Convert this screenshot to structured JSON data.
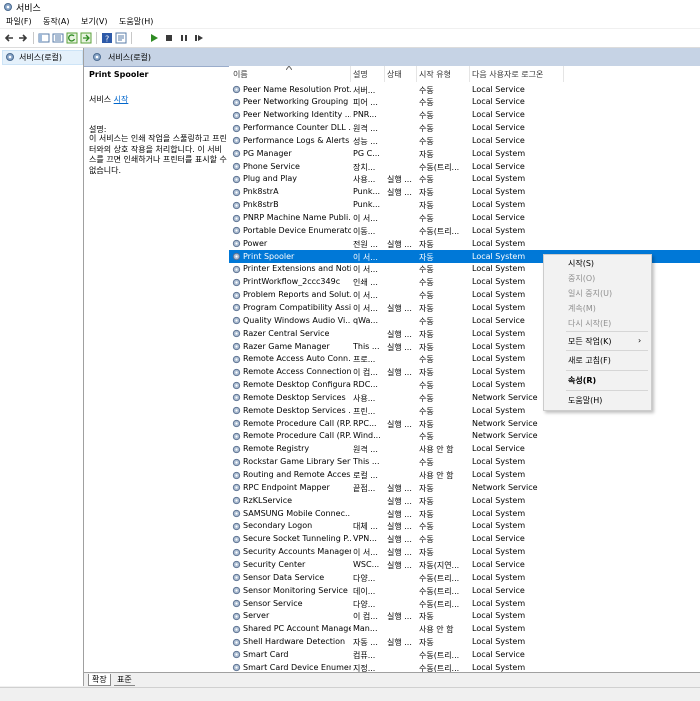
{
  "window": {
    "title": "서비스"
  },
  "menu": [
    "파일(F)",
    "동작(A)",
    "보기(V)",
    "도움말(H)"
  ],
  "tree": {
    "root_label": "서비스(로컬)"
  },
  "pane": {
    "header": "서비스(로컬)",
    "selected_service": "Print Spooler",
    "start_prefix": "서비스 ",
    "start_link": "시작",
    "desc_label": "설명:",
    "desc_text": "이 서비스는 인쇄 작업을 스풀링하고 프린터와의 상호 작용을 처리합니다. 이 서비스를 끄면 인쇄하거나 프린터를 표시할 수 없습니다."
  },
  "columns": [
    "이름",
    "설명",
    "상태",
    "시작 유형",
    "다음 사용자로 로그온"
  ],
  "services": [
    [
      "Peer Name Resolution Prot...",
      "서버...",
      "",
      "수동",
      "Local Service"
    ],
    [
      "Peer Networking Grouping",
      "피어 ...",
      "",
      "수동",
      "Local Service"
    ],
    [
      "Peer Networking Identity ...",
      "PNR...",
      "",
      "수동",
      "Local Service"
    ],
    [
      "Performance Counter DLL ...",
      "원격 ...",
      "",
      "수동",
      "Local Service"
    ],
    [
      "Performance Logs & Alerts",
      "성능 ...",
      "",
      "수동",
      "Local Service"
    ],
    [
      "PG Manager",
      "PG C...",
      "",
      "자동",
      "Local System"
    ],
    [
      "Phone Service",
      "장치...",
      "",
      "수동(트리...",
      "Local Service"
    ],
    [
      "Plug and Play",
      "사용...",
      "실행 ...",
      "수동",
      "Local System"
    ],
    [
      "Pnk8strA",
      "Punk...",
      "실행 ...",
      "자동",
      "Local System"
    ],
    [
      "Pnk8strB",
      "Punk...",
      "",
      "자동",
      "Local System"
    ],
    [
      "PNRP Machine Name Publi...",
      "이 서...",
      "",
      "수동",
      "Local Service"
    ],
    [
      "Portable Device Enumerato...",
      "이동...",
      "",
      "수동(트리...",
      "Local System"
    ],
    [
      "Power",
      "전원 ...",
      "실행 ...",
      "자동",
      "Local System"
    ],
    [
      "Print Spooler",
      "이 서...",
      "",
      "자동",
      "Local System"
    ],
    [
      "Printer Extensions and Noti...",
      "이 서...",
      "",
      "수동",
      "Local System"
    ],
    [
      "PrintWorkflow_2ccc349c",
      "인쇄 ...",
      "",
      "수동",
      "Local System"
    ],
    [
      "Problem Reports and Solut...",
      "이 서...",
      "",
      "수동",
      "Local System"
    ],
    [
      "Program Compatibility Assi...",
      "이 서...",
      "실행 ...",
      "자동",
      "Local System"
    ],
    [
      "Quality Windows Audio Vi...",
      "qWa...",
      "",
      "수동",
      "Local Service"
    ],
    [
      "Razer Central Service",
      "",
      "실행 ...",
      "자동",
      "Local System"
    ],
    [
      "Razer Game Manager",
      "This ...",
      "실행 ...",
      "자동",
      "Local System"
    ],
    [
      "Remote Access Auto Conn...",
      "프로...",
      "",
      "수동",
      "Local System"
    ],
    [
      "Remote Access Connection...",
      "이 컴...",
      "실행 ...",
      "자동",
      "Local System"
    ],
    [
      "Remote Desktop Configura...",
      "RDC...",
      "",
      "수동",
      "Local System"
    ],
    [
      "Remote Desktop Services",
      "사용...",
      "",
      "수동",
      "Network Service"
    ],
    [
      "Remote Desktop Services ...",
      "프린...",
      "",
      "수동",
      "Local System"
    ],
    [
      "Remote Procedure Call (RP...",
      "RPC...",
      "실행 ...",
      "자동",
      "Network Service"
    ],
    [
      "Remote Procedure Call (RP...",
      "Wind...",
      "",
      "수동",
      "Network Service"
    ],
    [
      "Remote Registry",
      "원격 ...",
      "",
      "사용 안 함",
      "Local Service"
    ],
    [
      "Rockstar Game Library Serv...",
      "This ...",
      "",
      "수동",
      "Local System"
    ],
    [
      "Routing and Remote Access",
      "로컬 ...",
      "",
      "사용 안 함",
      "Local System"
    ],
    [
      "RPC Endpoint Mapper",
      "끝점...",
      "실행 ...",
      "자동",
      "Network Service"
    ],
    [
      "RzKLService",
      "",
      "실행 ...",
      "자동",
      "Local System"
    ],
    [
      "SAMSUNG Mobile Connec...",
      "",
      "실행 ...",
      "자동",
      "Local System"
    ],
    [
      "Secondary Logon",
      "대체 ...",
      "실행 ...",
      "수동",
      "Local System"
    ],
    [
      "Secure Socket Tunneling P...",
      "VPN...",
      "실행 ...",
      "수동",
      "Local Service"
    ],
    [
      "Security Accounts Manager",
      "이 서...",
      "실행 ...",
      "자동",
      "Local System"
    ],
    [
      "Security Center",
      "WSC...",
      "실행 ...",
      "자동(지연...",
      "Local Service"
    ],
    [
      "Sensor Data Service",
      "다양...",
      "",
      "수동(트리...",
      "Local System"
    ],
    [
      "Sensor Monitoring Service",
      "데이...",
      "",
      "수동(트리...",
      "Local Service"
    ],
    [
      "Sensor Service",
      "다양...",
      "",
      "수동(트리...",
      "Local System"
    ],
    [
      "Server",
      "이 컴...",
      "실행 ...",
      "자동",
      "Local System"
    ],
    [
      "Shared PC Account Manager",
      "Man...",
      "",
      "사용 안 함",
      "Local System"
    ],
    [
      "Shell Hardware Detection",
      "자동 ...",
      "실행 ...",
      "자동",
      "Local System"
    ],
    [
      "Smart Card",
      "컴퓨...",
      "",
      "수동(트리...",
      "Local Service"
    ],
    [
      "Smart Card Device Enumer...",
      "지정...",
      "",
      "수동(트리...",
      "Local System"
    ]
  ],
  "selected_index": 13,
  "context_menu": [
    {
      "label": "시작(S)",
      "state": "enabled"
    },
    {
      "label": "중지(O)",
      "state": "disabled"
    },
    {
      "label": "일시 중지(U)",
      "state": "disabled"
    },
    {
      "label": "계속(M)",
      "state": "disabled"
    },
    {
      "label": "다시 시작(E)",
      "state": "disabled"
    },
    {
      "label": "모든 작업(K)",
      "state": "submenu"
    },
    {
      "label": "새로 고침(F)",
      "state": "enabled"
    },
    {
      "label": "속성(R)",
      "state": "bold"
    },
    {
      "label": "도움말(H)",
      "state": "enabled"
    }
  ],
  "tabs": [
    "확장",
    "표준"
  ],
  "colors": {
    "selection": "#0078d7",
    "link": "#0066cc",
    "pane_header": "#c6d3e5"
  }
}
